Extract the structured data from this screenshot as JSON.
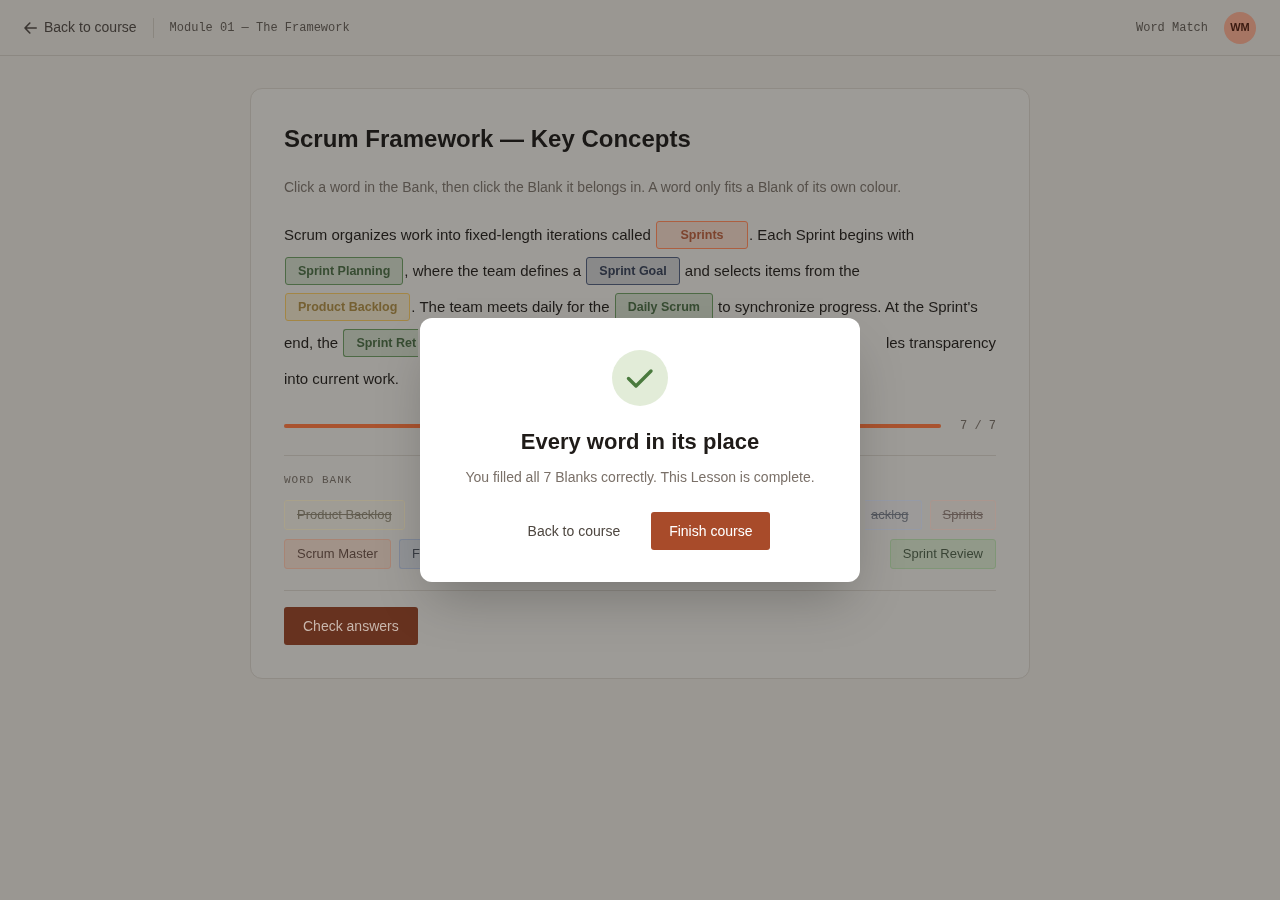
{
  "top_bar": {
    "back_link": "Back to course",
    "module": "Module 01 — The Framework",
    "app_name": "Word Match",
    "avatar": "WM"
  },
  "lesson": {
    "title": "Scrum Framework — Key Concepts",
    "instructions": "Click a word in the Bank, then click the Blank it belongs in. A word only fits a Blank of its own colour.",
    "passage": [
      [
        {
          "kind": "text",
          "text": "Scrum organizes work into fixed-length iterations called "
        },
        {
          "kind": "blank",
          "word": "Sprints",
          "color": "#ad5f40"
        },
        {
          "kind": "text",
          "text": ". Each Sprint begins with"
        }
      ],
      [
        {
          "kind": "blank",
          "word": "Sprint Planning",
          "color": "#4d6a45"
        },
        {
          "kind": "text",
          "text": ", where the team defines a "
        },
        {
          "kind": "blank",
          "word": "Sprint Goal",
          "color": "#3b4356"
        },
        {
          "kind": "text",
          "text": " and selects items from the"
        }
      ],
      [
        {
          "kind": "blank",
          "word": "Product Backlog",
          "color": "#a38645"
        },
        {
          "kind": "text",
          "text": ". The team meets daily for the "
        },
        {
          "kind": "blank",
          "word": "Daily Scrum",
          "color": "#4d6a45"
        },
        {
          "kind": "text",
          "text": " to synchronize progress. At the Sprint's"
        }
      ],
      [
        {
          "kind": "text",
          "text": "end, the "
        },
        {
          "kind": "blank",
          "word": "Sprint Ret",
          "color": "#4d6a45",
          "clipped": true
        },
        {
          "kind": "covered"
        },
        {
          "kind": "text",
          "text": "les transparency"
        }
      ],
      [
        {
          "kind": "text",
          "text": "into current work."
        }
      ]
    ],
    "progress": {
      "level": 1,
      "reading": "7 / 7"
    },
    "word_bank": {
      "label": "WORD BANK",
      "rows": [
        [
          {
            "kind": "word",
            "word": "Product Backlog",
            "color": "#a9a18a",
            "used": true,
            "clipped": false
          },
          {
            "kind": "covered"
          },
          {
            "kind": "word",
            "word": "acklog",
            "color": "#959aa6",
            "used": true,
            "clipped": true
          },
          {
            "kind": "word",
            "word": "Sprints",
            "color": "#ab968e",
            "used": true
          }
        ],
        [
          {
            "kind": "word",
            "word": "Scrum Master",
            "color": "#a88474",
            "used": false
          },
          {
            "kind": "word",
            "word": "F",
            "color": "#7f8797",
            "used": false,
            "clipped": true
          },
          {
            "kind": "covered"
          },
          {
            "kind": "word",
            "word": "Sprint Review",
            "color": "#7f9676",
            "used": false,
            "clipped": false
          }
        ]
      ]
    },
    "check_button": "Check answers"
  },
  "dialog": {
    "title": "Every word in its place",
    "message": "You filled all 7 Blanks correctly. This Lesson is complete.",
    "buttons": [
      {
        "label": "Back to course",
        "kind": "secondary"
      },
      {
        "label": "Finish course",
        "kind": "primary"
      }
    ]
  }
}
